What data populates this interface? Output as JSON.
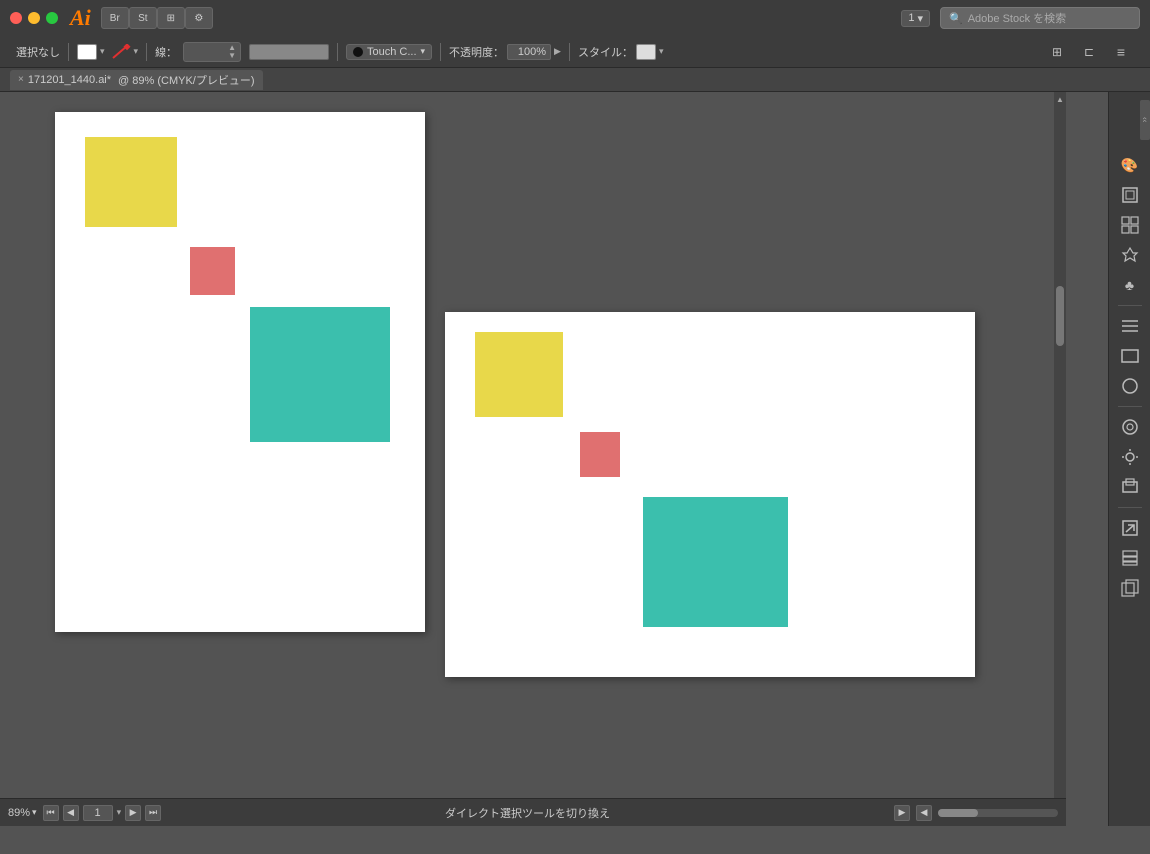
{
  "app": {
    "logo": "Ai",
    "title": "171201_1440.ai* @ 89% (CMYK/プレビュー)"
  },
  "titlebar": {
    "traffic_lights": [
      "red",
      "yellow",
      "green"
    ],
    "bridge_label": "Br",
    "stock_label": "St",
    "panel_grid_label": "⊞",
    "touch_icon_label": "⚙",
    "page_selector": "1",
    "page_selector_arrow": "▾",
    "search_placeholder": "Adobe Stock を検索"
  },
  "toolbar": {
    "selection_label": "選択なし",
    "fill_color": "#ffffff",
    "stroke_label": "線：",
    "stroke_color": "#555555",
    "touch_brush_label": "Touch C...",
    "opacity_label": "不透明度：",
    "opacity_value": "100%",
    "style_label": "スタイル：",
    "style_color": "#dddddd"
  },
  "tab": {
    "close_icon": "×",
    "filename": "171201_1440.ai*",
    "view_info": "@ 89% (CMYK/プレビュー)"
  },
  "canvas": {
    "artboard1": {
      "yellow_rect": {
        "color": "#e8d84a"
      },
      "pink_rect": {
        "color": "#e07070"
      },
      "teal_rect": {
        "color": "#3bbfad"
      }
    },
    "artboard2": {
      "yellow_rect": {
        "color": "#e8d84a"
      },
      "pink_rect": {
        "color": "#e07070"
      },
      "teal_rect": {
        "color": "#3bbfad"
      }
    }
  },
  "right_panel": {
    "icons": [
      {
        "name": "color-swatch-icon",
        "symbol": "🎨"
      },
      {
        "name": "artboard-icon",
        "symbol": "▣"
      },
      {
        "name": "table-icon",
        "symbol": "⊞"
      },
      {
        "name": "puppet-icon",
        "symbol": "✦"
      },
      {
        "name": "spade-icon",
        "symbol": "♣"
      },
      {
        "name": "separator1",
        "symbol": ""
      },
      {
        "name": "align-icon",
        "symbol": "≡"
      },
      {
        "name": "rect-icon",
        "symbol": "▭"
      },
      {
        "name": "circle-icon",
        "symbol": "◯"
      },
      {
        "name": "separator2",
        "symbol": ""
      },
      {
        "name": "layers-icon",
        "symbol": "⊙"
      },
      {
        "name": "sun-icon",
        "symbol": "☀"
      },
      {
        "name": "link-icon",
        "symbol": "⊏"
      },
      {
        "name": "separator3",
        "symbol": ""
      },
      {
        "name": "export-icon",
        "symbol": "↗"
      },
      {
        "name": "stack-icon",
        "symbol": "◈"
      },
      {
        "name": "copy-icon",
        "symbol": "⧉"
      }
    ]
  },
  "status_bar": {
    "zoom_value": "89%",
    "zoom_arrow": "▾",
    "page_current": "1",
    "page_arrow": "▾",
    "play_icon": "▶",
    "skip_end_icon": "⏭",
    "status_message": "ダイレクト選択ツールを切り換え",
    "right_arrow": "▶",
    "hide_arrow": "◀"
  }
}
